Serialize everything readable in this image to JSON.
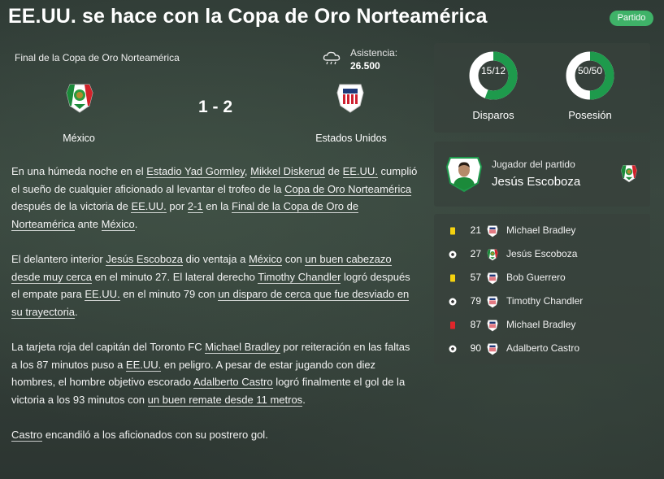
{
  "header": {
    "title": "EE.UU. se hace con la Copa de Oro Norteamérica",
    "badge": "Partido"
  },
  "match": {
    "competition": "Final de la Copa de Oro Norteamérica",
    "attendance_label": "Asistencia:",
    "attendance_value": "26.500",
    "weather_icon": "cloud-rain-icon",
    "score": "1 - 2",
    "home_team": "México",
    "away_team": "Estados Unidos"
  },
  "story": {
    "p1": [
      "En una húmeda noche en el ",
      {
        "l": "Estadio Yad Gormley"
      },
      ", ",
      {
        "l": "Mikkel Diskerud"
      },
      " de ",
      {
        "l": "EE.UU."
      },
      " cumplió el sueño de cualquier aficionado al levantar el trofeo de la ",
      {
        "l": "Copa de Oro Norteamérica"
      },
      " después de la victoria de ",
      {
        "l": "EE.UU."
      },
      " por ",
      {
        "l": "2-1"
      },
      " en la ",
      {
        "l": "Final de la Copa de Oro de Norteamérica"
      },
      " ante ",
      {
        "l": "México"
      },
      "."
    ],
    "p2": [
      "El delantero interior ",
      {
        "l": "Jesús Escoboza"
      },
      " dio ventaja a ",
      {
        "l": "México"
      },
      " con ",
      {
        "l": "un buen cabezazo desde muy cerca"
      },
      " en el minuto 27. El lateral derecho ",
      {
        "l": "Timothy Chandler"
      },
      " logró después el empate para ",
      {
        "l": "EE.UU."
      },
      " en el minuto 79 con ",
      {
        "l": "un disparo de cerca que fue desviado en su trayectoria"
      },
      "."
    ],
    "p3": [
      "La tarjeta roja del capitán del Toronto FC ",
      {
        "l": "Michael Bradley"
      },
      " por reiteración en las faltas a los 87 minutos puso a ",
      {
        "l": "EE.UU."
      },
      " en peligro. A pesar de estar jugando con diez hombres, el hombre objetivo escorado ",
      {
        "l": "Adalberto Castro"
      },
      " logró finalmente el gol de la victoria a los 93 minutos con ",
      {
        "l": "un buen remate desde 11 metros"
      },
      "."
    ],
    "p4": [
      {
        "l": "Castro"
      },
      " encandiló a los aficionados con su postrero gol."
    ]
  },
  "stats": {
    "shots": {
      "label": "Disparos",
      "value": "15/12",
      "fraction": 0.556
    },
    "possession": {
      "label": "Posesión",
      "value": "50/50",
      "fraction": 0.5
    }
  },
  "potm": {
    "label": "Jugador del partido",
    "name": "Jesús Escoboza"
  },
  "events": [
    {
      "type": "yellow",
      "icon": "yellow-card-icon",
      "minute": "21",
      "team": "away",
      "player": "Michael Bradley"
    },
    {
      "type": "goal",
      "icon": "ball-icon",
      "minute": "27",
      "team": "home",
      "player": "Jesús Escoboza"
    },
    {
      "type": "yellow",
      "icon": "yellow-card-icon",
      "minute": "57",
      "team": "away",
      "player": "Bob Guerrero"
    },
    {
      "type": "goal",
      "icon": "ball-icon",
      "minute": "79",
      "team": "away",
      "player": "Timothy Chandler"
    },
    {
      "type": "red",
      "icon": "red-card-icon",
      "minute": "87",
      "team": "away",
      "player": "Michael Bradley"
    },
    {
      "type": "goal",
      "icon": "ball-icon",
      "minute": "90",
      "team": "away",
      "player": "Adalberto Castro"
    }
  ],
  "colors": {
    "accent_green": "#3fb268",
    "donut_green": "#1e9a4c",
    "yellow_card": "#f5d20f",
    "red_card": "#e0262b"
  }
}
